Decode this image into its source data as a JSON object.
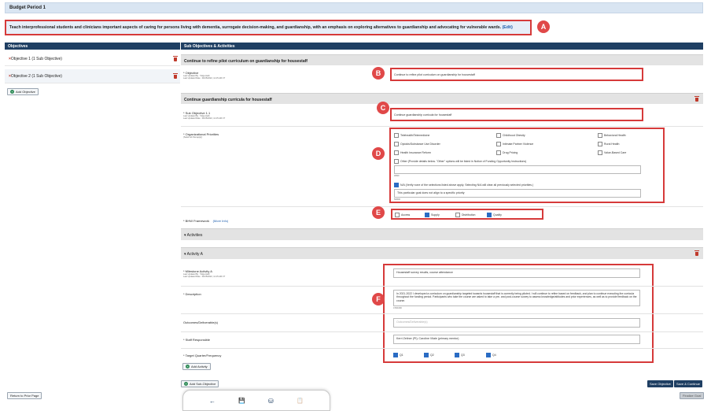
{
  "budget_period": "Budget Period 1",
  "goal": {
    "text": "Teach interprofessional students and clinicians important aspects of caring for persons living with dementia, surrogate decision-making, and guardianship, with an emphasis on exploring alternatives to guardianship and advocating for vulnerable wards.",
    "edit_label": "(Edit)"
  },
  "objectives_panel": {
    "header": "Objectives",
    "items": [
      {
        "label": "Objective 1 (1 Sub Objective)"
      },
      {
        "label": "Objective 2 (1 Sub Objective)"
      }
    ],
    "add_button": "Add Objective"
  },
  "sub_panel": {
    "header": "Sub Objectives & Activities",
    "objective_title": "Continue to refine pilot curriculum on guardianship for housestaff",
    "objective_field": {
      "label": "* Objective",
      "updated_by": "Last Updated By : Tolga Hath",
      "updated_date": "Last Updated Date : 09/15/2022, 11:15 AM CT",
      "value": "Continue to refine pilot curriculum on guardianship for housestaff"
    },
    "sub_title": "Continue guardianship curricula for housestaff",
    "sub_field": {
      "label": "* Sub Objective 1.1",
      "updated_by": "Last Updated By : Tolga Hath",
      "updated_date": "Last Updated Date : 09/15/2022, 11:15 AM CT",
      "value": "Continue guardianship curricula for housestaff"
    },
    "org_priorities": {
      "label": "* Organizational Priorities",
      "hint": "(Select all that apply)",
      "options": [
        {
          "label": "Telehealth/Telemedicine",
          "checked": false
        },
        {
          "label": "Childhood Obesity",
          "checked": false
        },
        {
          "label": "Behavioral Health",
          "checked": false
        },
        {
          "label": "Opioids/Substance Use Disorder",
          "checked": false
        },
        {
          "label": "Intimate Partner Violence",
          "checked": false
        },
        {
          "label": "Rural Health",
          "checked": false
        },
        {
          "label": "Health Insurance Reform",
          "checked": false
        },
        {
          "label": "Drug Pricing",
          "checked": false
        },
        {
          "label": "Value-Based Care",
          "checked": false
        }
      ],
      "other_label": "Other (Provide details below. \"Other\" options will be listed in Notice of Funding Opportunity Instructions)",
      "other_counter": "0/500",
      "na_label": "N/A (Verify none of the selections listed above apply. Selecting N/A will clear all previously selected priorities.)",
      "na_checked": true,
      "na_text": "This particular goal does not align to a specific priority",
      "na_counter": "59/500"
    },
    "bhw": {
      "label": "* BHW Framework",
      "more_info": "(More Info)",
      "options": [
        {
          "label": "Access",
          "checked": false
        },
        {
          "label": "Supply",
          "checked": true
        },
        {
          "label": "Distribution",
          "checked": false
        },
        {
          "label": "Quality",
          "checked": true
        }
      ]
    },
    "activities_title": "Activities",
    "activity_title": "Activity A",
    "milestone": {
      "label": "* Milestone Activity A",
      "updated_by": "Last Updated By : Tolga Hath",
      "updated_date": "Last Updated Date : 09/15/2022, 11:15 AM CT",
      "value": "Housestaff survey results, course attendance"
    },
    "description": {
      "label": "* Description",
      "value": "In 2021-2022 I developed a curriculum on guardianship targeted towards housestaff that is currently being piloted. I will continue to refine based on feedback, and plan to continue executing the curricula throughout the funding period. Participants who take the course are asked to take a pre- and post-course survey to assess knowledge/attitudes and prior experiences, as well as to provide feedback on the course.",
      "counter": "473/1000"
    },
    "outcomes": {
      "label": "Outcomes/Deliverable(s)",
      "placeholder": "Outcomes/Deliverable(s)"
    },
    "staff": {
      "label": "* Staff Responsible",
      "value": "Kerri Zeltner (PI); Caroline Vitale (primary mentor)"
    },
    "quarters": {
      "label": "* Target Quarter/Frequency",
      "options": [
        {
          "label": "Q1",
          "checked": true
        },
        {
          "label": "Q2",
          "checked": true
        },
        {
          "label": "Q3",
          "checked": true
        },
        {
          "label": "Q4",
          "checked": true
        }
      ]
    },
    "add_activity": "Add Activity",
    "add_sub_objective": "Add Sub-Objective",
    "save_objective": "Save Objective",
    "save_continue": "Save & Continue",
    "finalize_goal": "Finalize Goal"
  },
  "return_button": "Return to Prior Page",
  "callouts": [
    "A",
    "B",
    "C",
    "D",
    "E",
    "F"
  ],
  "toolbar": {
    "back_icon": "←",
    "save_icon": "💾",
    "save_all_icon": "⛁",
    "clipboard_icon": "📋"
  }
}
